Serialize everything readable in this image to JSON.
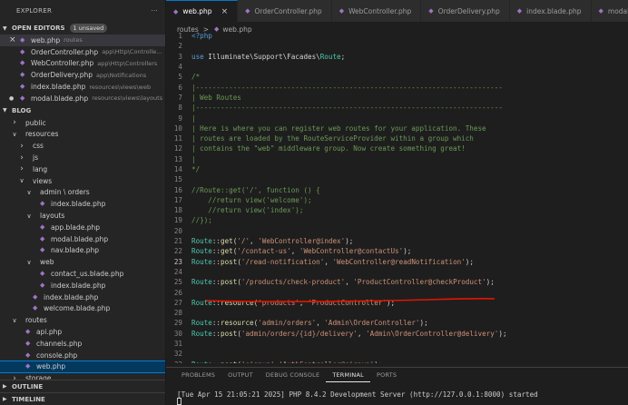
{
  "explorer": {
    "title": "EXPLORER",
    "more": "···",
    "open_editors_label": "OPEN EDITORS",
    "unsaved_badge": "1 unsaved",
    "open_editors": [
      {
        "name": "web.php",
        "path": "routes"
      },
      {
        "name": "OrderController.php",
        "path": "app\\Http\\Controlle..."
      },
      {
        "name": "WebController.php",
        "path": "app\\Http\\Controllers"
      },
      {
        "name": "OrderDelivery.php",
        "path": "app\\Notifications"
      },
      {
        "name": "index.blade.php",
        "path": "resources\\views\\web"
      },
      {
        "name": "modal.blade.php",
        "path": "resources\\views\\layouts"
      }
    ],
    "project_label": "BLOG",
    "tree": [
      {
        "label": "public",
        "kind": "folder",
        "open": false,
        "depth": 1
      },
      {
        "label": "resources",
        "kind": "folder",
        "open": true,
        "depth": 1
      },
      {
        "label": "css",
        "kind": "folder",
        "open": false,
        "depth": 2
      },
      {
        "label": "js",
        "kind": "folder",
        "open": false,
        "depth": 2
      },
      {
        "label": "lang",
        "kind": "folder",
        "open": false,
        "depth": 2
      },
      {
        "label": "views",
        "kind": "folder",
        "open": true,
        "depth": 2
      },
      {
        "label": "admin \\ orders",
        "kind": "folder",
        "open": true,
        "depth": 3
      },
      {
        "label": "index.blade.php",
        "kind": "file",
        "depth": 4
      },
      {
        "label": "layouts",
        "kind": "folder",
        "open": true,
        "depth": 3
      },
      {
        "label": "app.blade.php",
        "kind": "file",
        "depth": 4
      },
      {
        "label": "modal.blade.php",
        "kind": "file",
        "depth": 4
      },
      {
        "label": "nav.blade.php",
        "kind": "file",
        "depth": 4
      },
      {
        "label": "web",
        "kind": "folder",
        "open": true,
        "depth": 3
      },
      {
        "label": "contact_us.blade.php",
        "kind": "file",
        "depth": 4
      },
      {
        "label": "index.blade.php",
        "kind": "file",
        "depth": 4
      },
      {
        "label": "index.blade.php",
        "kind": "file",
        "depth": 3
      },
      {
        "label": "welcome.blade.php",
        "kind": "file",
        "depth": 3
      },
      {
        "label": "routes",
        "kind": "folder",
        "open": true,
        "depth": 1
      },
      {
        "label": "api.php",
        "kind": "file",
        "depth": 2
      },
      {
        "label": "channels.php",
        "kind": "file",
        "depth": 2
      },
      {
        "label": "console.php",
        "kind": "file",
        "depth": 2
      },
      {
        "label": "web.php",
        "kind": "file",
        "depth": 2,
        "active": true
      },
      {
        "label": "storage",
        "kind": "folder",
        "open": false,
        "depth": 1
      }
    ],
    "outline_label": "OUTLINE",
    "timeline_label": "TIMELINE"
  },
  "tabs": [
    {
      "label": "web.php",
      "active": true
    },
    {
      "label": "OrderController.php"
    },
    {
      "label": "WebController.php"
    },
    {
      "label": "OrderDelivery.php"
    },
    {
      "label": "index.blade.php"
    },
    {
      "label": "modal.blad"
    }
  ],
  "breadcrumb": {
    "folder": "routes",
    "sep": ">",
    "file": "web.php"
  },
  "code_lines": [
    {
      "n": "1",
      "html": "<span class='kw'>&lt;?php</span>"
    },
    {
      "n": "2",
      "html": ""
    },
    {
      "n": "3",
      "html": "<span class='kw'>use</span> Illuminate\\Support\\Facades\\<span class='cl'>Route</span>;"
    },
    {
      "n": "4",
      "html": ""
    },
    {
      "n": "5",
      "html": "<span class='cm'>/*</span>"
    },
    {
      "n": "6",
      "html": "<span class='cm'>|--------------------------------------------------------------------------</span>"
    },
    {
      "n": "7",
      "html": "<span class='cm'>| Web Routes</span>"
    },
    {
      "n": "8",
      "html": "<span class='cm'>|--------------------------------------------------------------------------</span>"
    },
    {
      "n": "9",
      "html": "<span class='cm'>|</span>"
    },
    {
      "n": "10",
      "html": "<span class='cm'>| Here is where you can register web routes for your application. These</span>"
    },
    {
      "n": "11",
      "html": "<span class='cm'>| routes are loaded by the RouteServiceProvider within a group which</span>"
    },
    {
      "n": "12",
      "html": "<span class='cm'>| contains the \"web\" middleware group. Now create something great!</span>"
    },
    {
      "n": "13",
      "html": "<span class='cm'>|</span>"
    },
    {
      "n": "14",
      "html": "<span class='cm'>*/</span>"
    },
    {
      "n": "15",
      "html": ""
    },
    {
      "n": "16",
      "html": "<span class='cm'>//Route::get('/', function () {</span>"
    },
    {
      "n": "17",
      "html": "<span class='cm'>    //return view('welcome');</span>"
    },
    {
      "n": "18",
      "html": "<span class='cm'>    //return view('index');</span>"
    },
    {
      "n": "19",
      "html": "<span class='cm'>//});</span>"
    },
    {
      "n": "20",
      "html": ""
    },
    {
      "n": "21",
      "html": "<span class='cl'>Route</span>::<span class='fn'>get</span>(<span class='st'>'/'</span>, <span class='st'>'WebController@index'</span>);"
    },
    {
      "n": "22",
      "html": "<span class='cl'>Route</span>::<span class='fn'>get</span>(<span class='st'>'/contact-us'</span>, <span class='st'>'WebController@contactUs'</span>);"
    },
    {
      "n": "23",
      "html": "<span class='cl'>Route</span>::<span class='fn'>post</span>(<span class='st'>'/read-notification'</span>, <span class='st'>'WebController@readNotification'</span>);",
      "cur": true
    },
    {
      "n": "24",
      "html": ""
    },
    {
      "n": "25",
      "html": "<span class='cl'>Route</span>::<span class='fn'>post</span>(<span class='st'>'/products/check-product'</span>, <span class='st'>'ProductController@checkProduct'</span>);"
    },
    {
      "n": "26",
      "html": ""
    },
    {
      "n": "27",
      "html": "<span class='cl'>Route</span>::<span class='fn'>resource</span>(<span class='st'>'products'</span>, <span class='st'>'ProductController'</span>);"
    },
    {
      "n": "28",
      "html": ""
    },
    {
      "n": "29",
      "html": "<span class='cl'>Route</span>::<span class='fn'>resource</span>(<span class='st'>'admin/orders'</span>, <span class='st'>'Admin\\OrderController'</span>);"
    },
    {
      "n": "30",
      "html": "<span class='cl'>Route</span>::<span class='fn'>post</span>(<span class='st'>'admin/orders/{id}/delivery'</span>, <span class='st'>'Admin\\OrderController@delivery'</span>);"
    },
    {
      "n": "31",
      "html": ""
    },
    {
      "n": "32",
      "html": ""
    },
    {
      "n": "33",
      "html": "<span class='cl'>Route</span>::<span class='fn'>post</span>(<span class='st'>'signup'</span>,<span class='st'>'AuthController@signup'</span>);"
    }
  ],
  "panel": {
    "tabs": [
      "PROBLEMS",
      "OUTPUT",
      "DEBUG CONSOLE",
      "TERMINAL",
      "PORTS"
    ],
    "active_tab": "TERMINAL",
    "terminal_line": "[Tue Apr 15 21:05:21 2025] PHP 8.4.2 Development Server (http://127.0.0.1:8000) started"
  },
  "colors": {
    "accent": "#007acc",
    "annotation": "#e51400",
    "php_icon": "#a074c4"
  }
}
